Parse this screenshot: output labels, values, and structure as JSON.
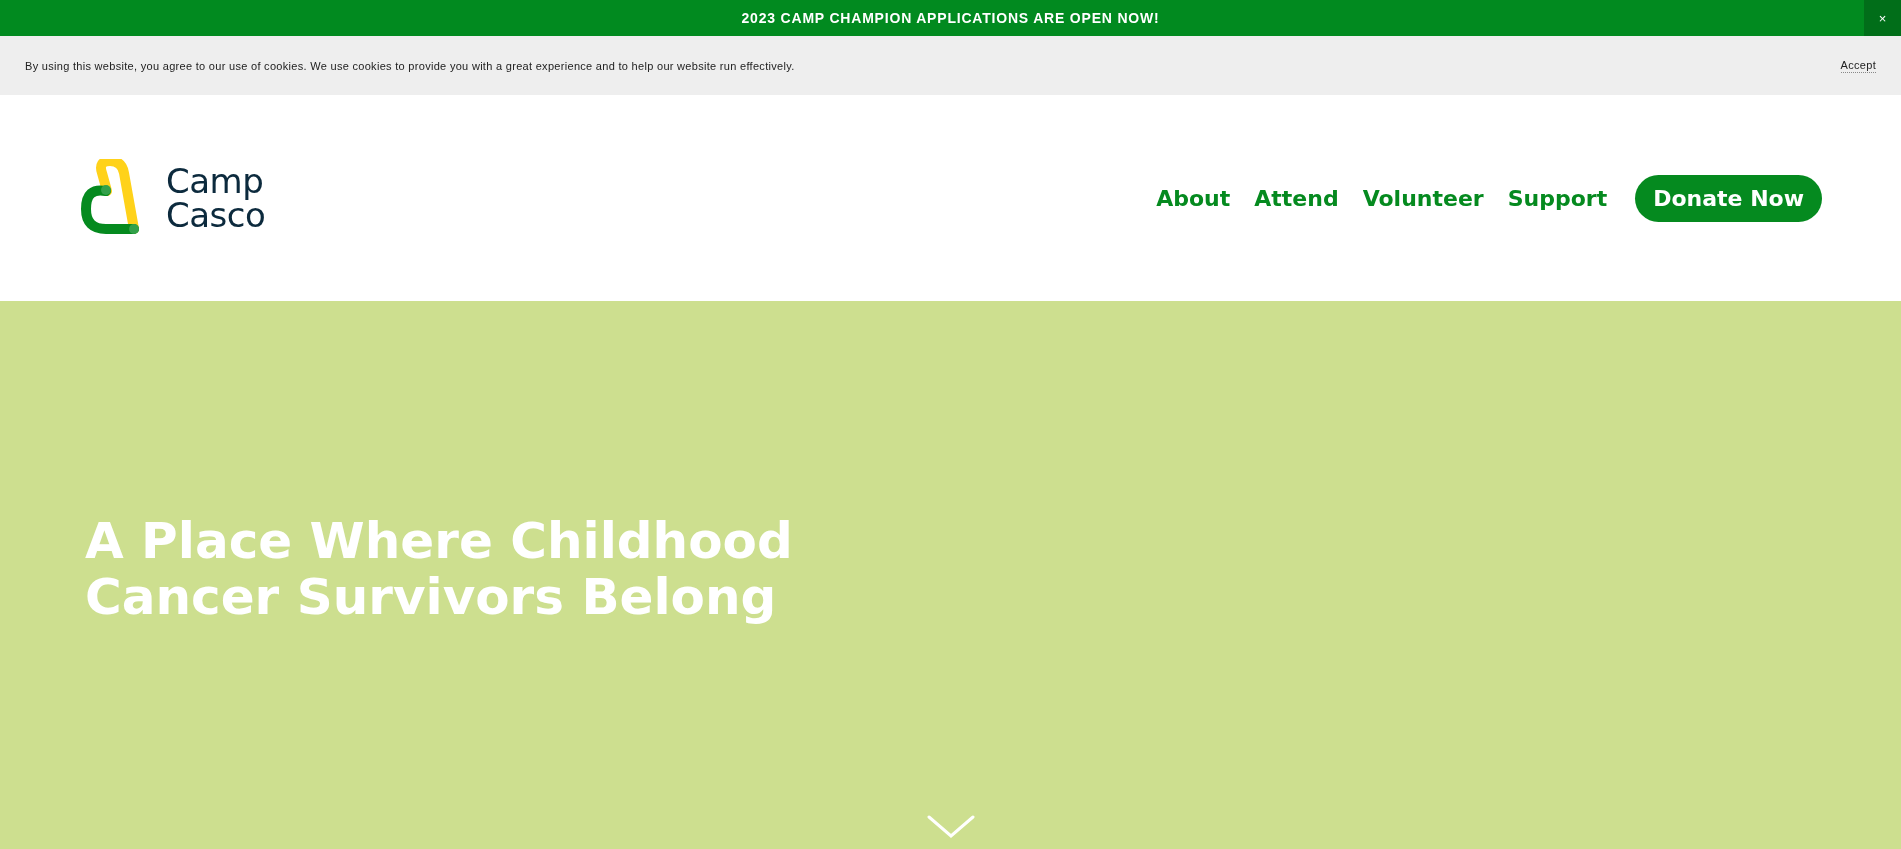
{
  "announcement": {
    "text": "2023 CAMP CHAMPION APPLICATIONS ARE OPEN NOW!",
    "close": "×"
  },
  "cookie_notice": {
    "text": "By using this website, you agree to our use of cookies. We use cookies to provide you with a great experience and to help our website run effectively.",
    "accept": "Accept"
  },
  "logo": {
    "line_1": "Camp",
    "line_2": "Casco"
  },
  "nav": [
    {
      "label": "About",
      "kind": "link"
    },
    {
      "label": "Attend",
      "kind": "link"
    },
    {
      "label": "Volunteer",
      "kind": "link"
    },
    {
      "label": "Support",
      "kind": "link"
    },
    {
      "label": "Donate Now",
      "kind": "button"
    }
  ],
  "hero": {
    "headline": "A Place Where Childhood Cancer Survivors Belong"
  }
}
